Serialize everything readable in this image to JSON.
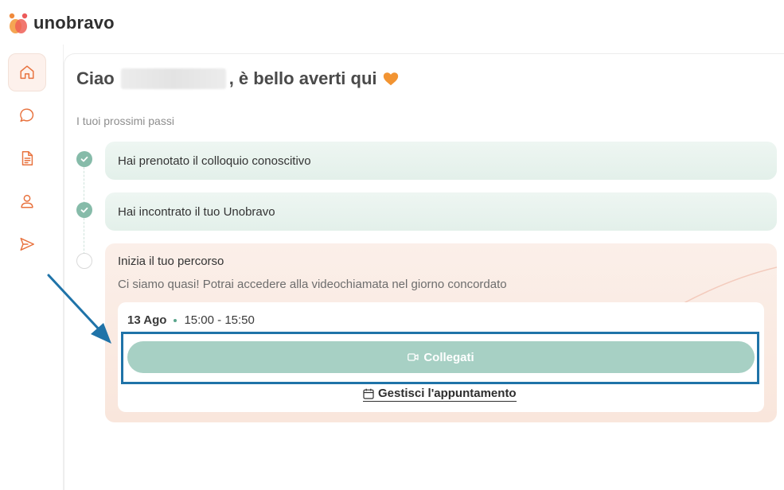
{
  "brand": {
    "name": "unobravo",
    "accent": "#e8723e"
  },
  "sidebar": {
    "items": [
      {
        "icon": "home-icon",
        "active": true
      },
      {
        "icon": "chat-icon",
        "active": false
      },
      {
        "icon": "document-icon",
        "active": false
      },
      {
        "icon": "user-icon",
        "active": false
      },
      {
        "icon": "send-icon",
        "active": false
      }
    ]
  },
  "greeting": {
    "prefix": "Ciao",
    "suffix": ", è bello averti qui"
  },
  "steps": {
    "heading": "I tuoi prossimi passi",
    "items": [
      {
        "label": "Hai prenotato il colloquio conoscitivo",
        "status": "done"
      },
      {
        "label": "Hai incontrato il tuo Unobravo",
        "status": "done"
      },
      {
        "label": "Inizia il tuo percorso",
        "status": "current",
        "description": "Ci siamo quasi! Potrai accedere alla videochiamata nel giorno concordato"
      }
    ]
  },
  "appointment": {
    "date": "13 Ago",
    "time": "15:00 - 15:50",
    "join_label": "Collegati",
    "manage_label": "Gestisci l'appuntamento"
  },
  "colors": {
    "done_green": "#86bba9",
    "join_button": "#a7d0c4",
    "highlight_blue": "#1f73a8"
  }
}
